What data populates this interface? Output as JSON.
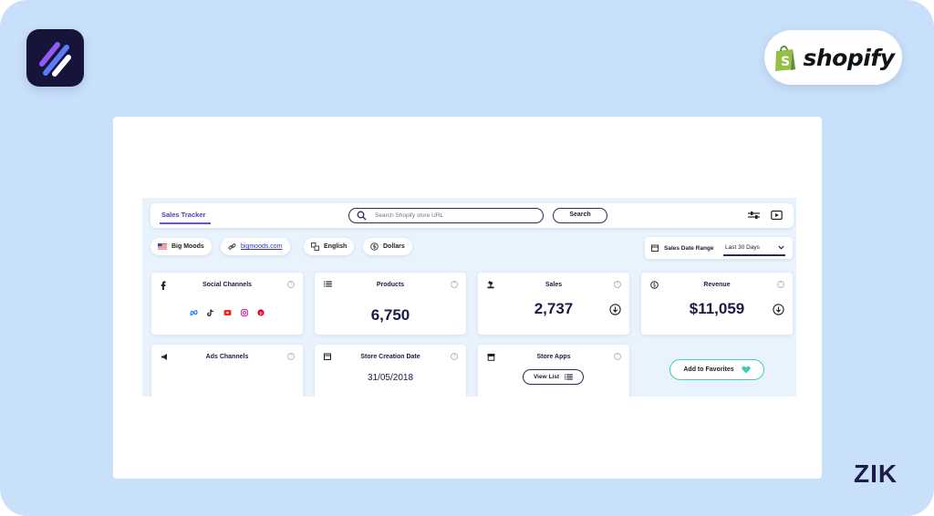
{
  "brand": {
    "partner_name": "shopify",
    "watermark": "ZIK"
  },
  "topbar": {
    "tab_label": "Sales Tracker",
    "search_placeholder": "Search Shopify store URL",
    "search_button": "Search"
  },
  "store": {
    "name": "Big Moods",
    "url": "bigmoods.com",
    "language": "English",
    "currency": "Dollars"
  },
  "date_range": {
    "label": "Sales Date Range",
    "selected": "Last 30 Days"
  },
  "stats": {
    "social": {
      "title": "Social Channels"
    },
    "products": {
      "title": "Products",
      "value": "6,750"
    },
    "sales": {
      "title": "Sales",
      "value": "2,737"
    },
    "revenue": {
      "title": "Revenue",
      "value": "$11,059"
    },
    "ads": {
      "title": "Ads Channels"
    },
    "creation": {
      "title": "Store Creation Date",
      "value": "31/05/2018"
    },
    "apps": {
      "title": "Store Apps",
      "button": "View List"
    }
  },
  "favorites_button": "Add to Favorites",
  "colors": {
    "background": "#c9e0fb",
    "accent": "#6b4fd8",
    "navy": "#1c1a48",
    "teal": "#3dcdb8",
    "shopify_green": "#95bf47"
  },
  "icons": [
    "app-logo-icon",
    "shopify-bag-icon",
    "search-icon",
    "filter-sliders-icon",
    "video-icon",
    "us-flag-icon",
    "link-icon",
    "translate-icon",
    "dollar-icon",
    "calendar-icon",
    "chevron-down-icon",
    "facebook-icon",
    "list-icon",
    "gavel-icon",
    "download-icon",
    "megaphone-icon",
    "store-icon",
    "meta-icon",
    "tiktok-icon",
    "youtube-icon",
    "instagram-icon",
    "pinterest-icon",
    "heart-icon"
  ]
}
